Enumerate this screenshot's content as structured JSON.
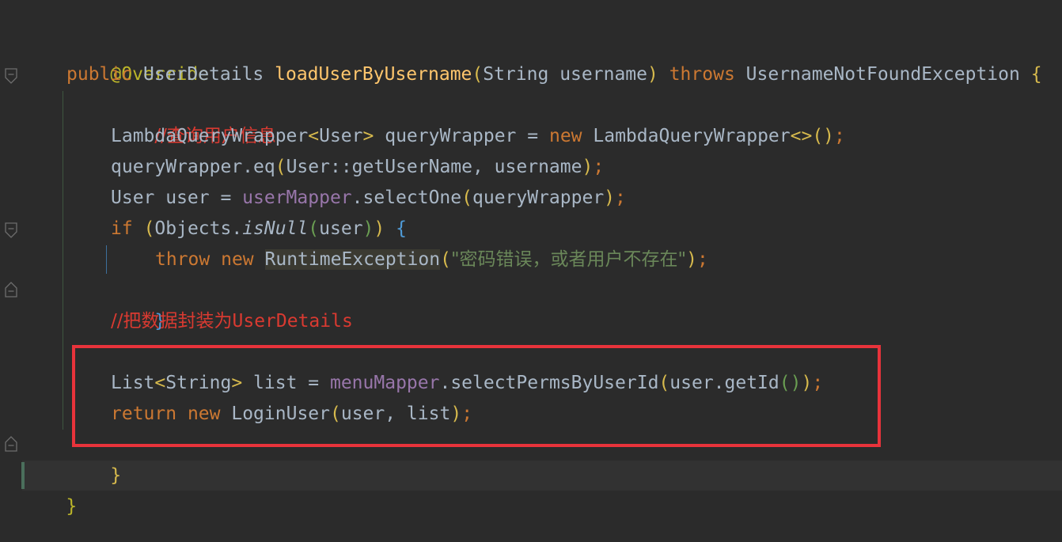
{
  "code": {
    "annotation": "@Override",
    "signature": {
      "mod": "public",
      "ret_type": "UserDetails",
      "method": "loadUserByUsername",
      "lparen": "(",
      "param_type": "String",
      "param_name": "username",
      "rparen": ")",
      "throws_kw": "throws",
      "exception": "UsernameNotFoundException",
      "open_brace": "{"
    },
    "comment1": "//查询用户信息",
    "line_wrapper": {
      "type_a": "LambdaQueryWrapper",
      "lt": "<",
      "generic": "User",
      "gt": ">",
      "var": "queryWrapper",
      "eq": "=",
      "new_kw": "new",
      "type_b": "LambdaQueryWrapper",
      "diamond": "<>",
      "parens": "()",
      "semi": ";"
    },
    "line_eq": {
      "call": "queryWrapper.eq",
      "lparen": "(",
      "args": "User::getUserName, username",
      "rparen": ")",
      "semi": ";"
    },
    "line_user": {
      "decl": "User user = ",
      "field": "userMapper",
      "call": ".selectOne",
      "lparen": "(",
      "arg": "queryWrapper",
      "rparen": ")",
      "semi": ";"
    },
    "line_if": {
      "kw": "if",
      "lparen": "(",
      "obj": "Objects.",
      "static_call": "isNull",
      "lparen2": "(",
      "arg": "user",
      "rparen2": ")",
      "rparen": ")",
      "brace": "{"
    },
    "line_throw": {
      "throw_kw": "throw",
      "new_kw": "new",
      "exception": "RuntimeException",
      "lparen": "(",
      "message": "\"密码错误，或者用户不存在\"",
      "rparen": ")",
      "semi": ";"
    },
    "close_if": "}",
    "comment2_prefix": "//把数据封装为",
    "comment2_suffix": "UserDetails",
    "line_list": {
      "type": "List",
      "lt": "<",
      "generic": "String",
      "gt": ">",
      "decl": " list = ",
      "field": "menuMapper",
      "call": ".selectPermsByUserId",
      "lparen": "(",
      "arg": "user.getId",
      "inner_parens": "()",
      "rparen": ")",
      "semi": ";"
    },
    "line_return": {
      "return_kw": "return",
      "new_kw": "new",
      "type": "LoginUser",
      "lparen": "(",
      "args": "user, list",
      "rparen": ")",
      "semi": ";"
    },
    "close_method": "}",
    "close_class": "}"
  },
  "colors": {
    "background": "#2b2b2b",
    "keyword": "#cc7832",
    "annotation": "#bbb529",
    "method": "#ffc66d",
    "field": "#9876aa",
    "string": "#6a8759",
    "comment": "#d93a31",
    "text": "#a9b7c6",
    "highlight_box": "#e8333b"
  }
}
